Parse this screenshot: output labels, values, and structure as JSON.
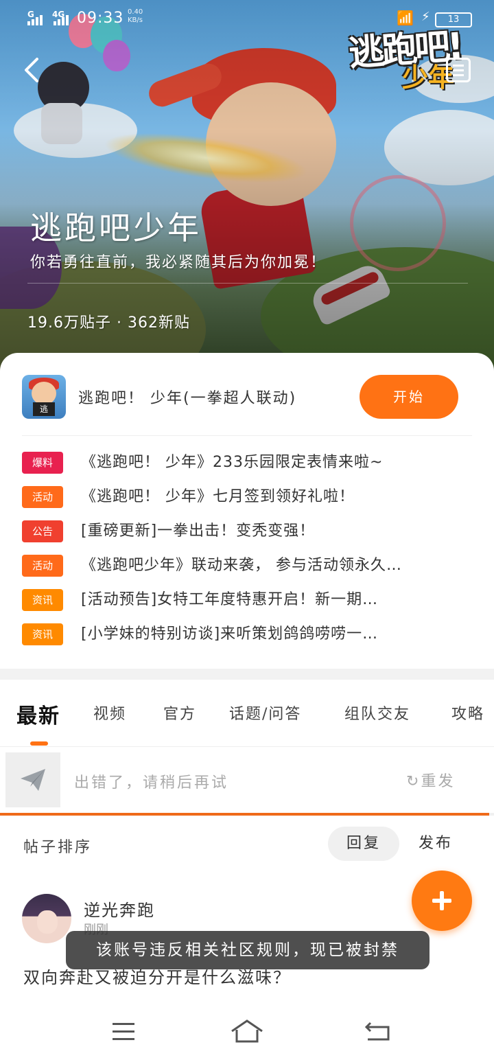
{
  "status_bar": {
    "signal_1": "G",
    "signal_2": "4G",
    "time": "09:33",
    "speed_value": "0.40",
    "speed_unit": "KB/s",
    "battery": "13"
  },
  "hero": {
    "logo_text": "逃跑吧!",
    "logo_sub": "少年",
    "title": "逃跑吧少年",
    "subtitle": "你若勇往直前，我必紧随其后为你加冕！",
    "stats": "19.6万贴子 · 362新贴"
  },
  "game": {
    "icon_tag": "逃",
    "name": "逃跑吧！ 少年(一拳超人联动)",
    "start_label": "开始"
  },
  "news": [
    {
      "tag": "爆料",
      "tag_color": "#e8214f",
      "text": "《逃跑吧！ 少年》233乐园限定表情来啦~"
    },
    {
      "tag": "活动",
      "tag_color": "#ff6a1a",
      "text": "《逃跑吧！ 少年》七月签到领好礼啦！"
    },
    {
      "tag": "公告",
      "tag_color": "#f0402f",
      "text": "[重磅更新]一拳出击！变秃变强！"
    },
    {
      "tag": "活动",
      "tag_color": "#ff6a1a",
      "text": "《逃跑吧少年》联动来袭， 参与活动领永久…"
    },
    {
      "tag": "资讯",
      "tag_color": "#ff8a00",
      "text": "[活动预告]女特工年度特惠开启！新一期…"
    },
    {
      "tag": "资讯",
      "tag_color": "#ff8a00",
      "text": "[小学妹的特别访谈]来听策划鸽鸽唠唠一…"
    }
  ],
  "tabs": [
    "最新",
    "视频",
    "官方",
    "话题/问答",
    "组队交友",
    "攻略"
  ],
  "error_bar": {
    "message": "出错了，请稍后再试",
    "resend_icon": "refresh-icon",
    "resend_label": "重发",
    "progress": 0.99
  },
  "sort": {
    "label": "帖子排序",
    "reply": "回复",
    "publish": "发布"
  },
  "post": {
    "author": "逆光奔跑",
    "time": "刚刚",
    "text": "双向奔赴又被迫分开是什么滋味？"
  },
  "toast": "该账号违反相关社区规则，现已被封禁",
  "colors": {
    "accent": "#ff7214",
    "progress": "#ef6a1a"
  }
}
